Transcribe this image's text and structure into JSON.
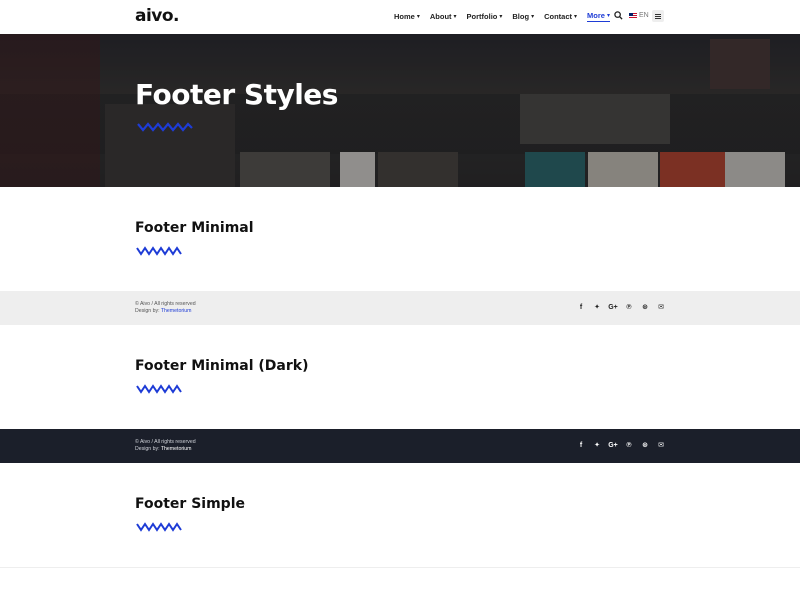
{
  "header": {
    "logo": "aivo.",
    "nav": [
      {
        "label": "Home",
        "caret": "⌄"
      },
      {
        "label": "About",
        "caret": "⌄"
      },
      {
        "label": "Portfolio",
        "caret": "⌄"
      },
      {
        "label": "Blog",
        "caret": "⌄"
      },
      {
        "label": "Contact",
        "caret": "⌄"
      },
      {
        "label": "More",
        "caret": "⌄"
      }
    ],
    "language": "EN",
    "icons": [
      "search-icon",
      "flag-icon",
      "menu-icon"
    ]
  },
  "hero": {
    "title": "Footer Styles"
  },
  "sections": [
    {
      "title": "Footer Minimal"
    },
    {
      "title": "Footer Minimal (Dark)"
    },
    {
      "title": "Footer Simple"
    }
  ],
  "footer_light": {
    "copyright": "© Aivo / All rights reserved",
    "design_prefix": "Design by: ",
    "design_link": "Themetorium",
    "social": [
      "f",
      "🐦",
      "G+",
      "P",
      "⊛",
      "✉"
    ]
  },
  "footer_dark": {
    "copyright": "© Aivo / All rights reserved",
    "design_prefix": "Design by: ",
    "design_link": "Themetorium",
    "social": [
      "f",
      "🐦",
      "G+",
      "P",
      "⊛",
      "✉"
    ]
  },
  "colors": {
    "accent": "#1e3cd6",
    "dark_footer": "#1b1f2a",
    "light_footer": "#eeeeee"
  }
}
